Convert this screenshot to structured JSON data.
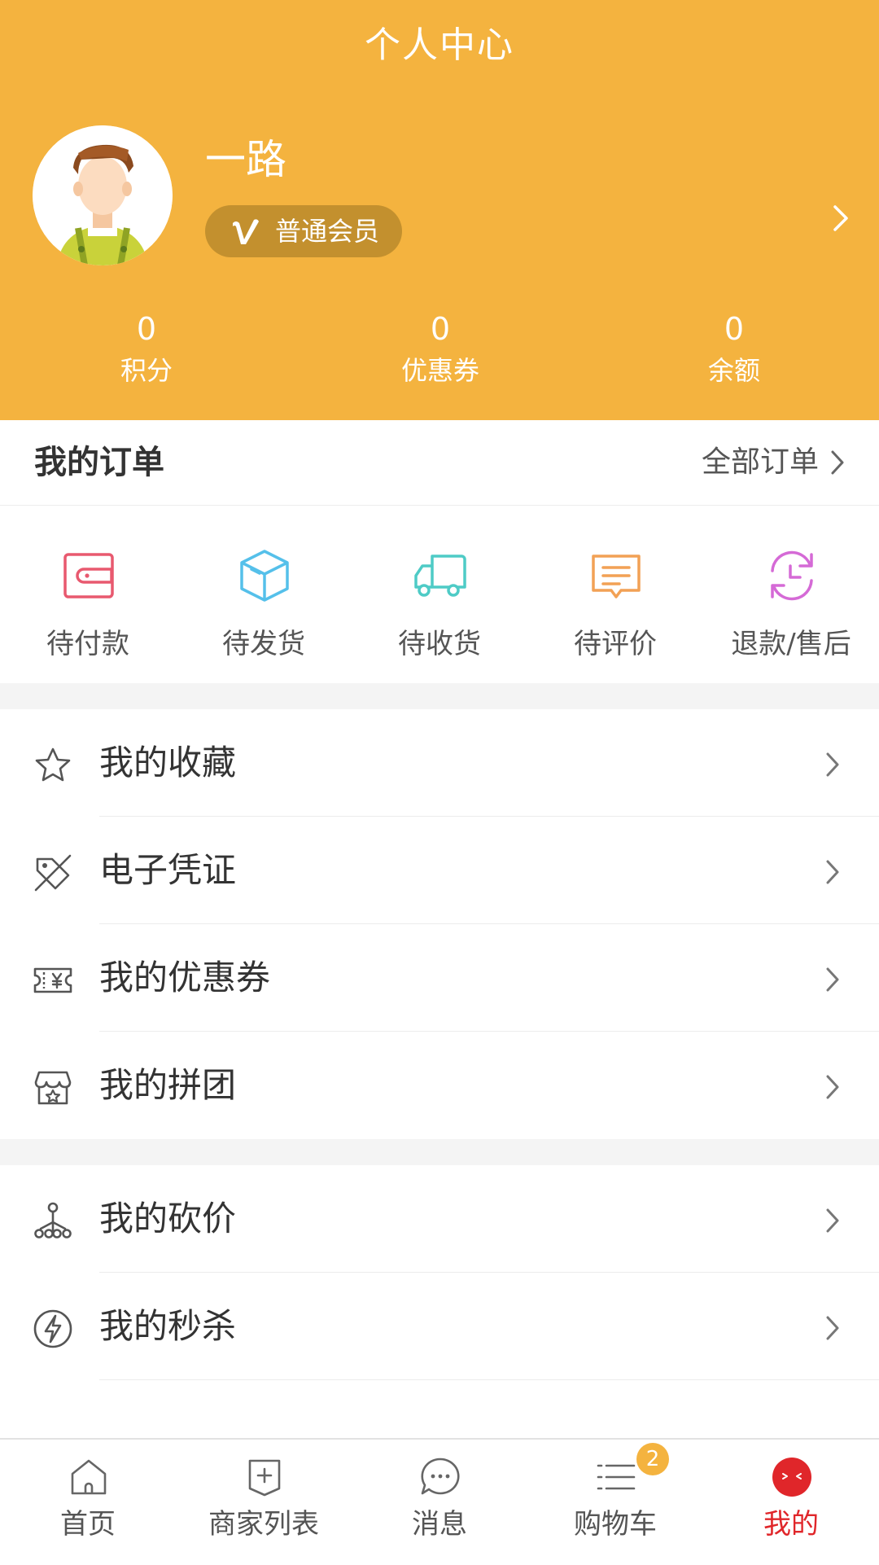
{
  "header": {
    "title": "个人中心",
    "username": "一路",
    "member_level": "普通会员",
    "stats": [
      {
        "value": "0",
        "label": "积分"
      },
      {
        "value": "0",
        "label": "优惠券"
      },
      {
        "value": "0",
        "label": "余额"
      }
    ]
  },
  "orders": {
    "title": "我的订单",
    "all_label": "全部订单",
    "statuses": [
      {
        "label": "待付款",
        "icon": "wallet-icon",
        "color": "#e8596f"
      },
      {
        "label": "待发货",
        "icon": "box-icon",
        "color": "#55c0ea"
      },
      {
        "label": "待收货",
        "icon": "truck-icon",
        "color": "#4ecbc6"
      },
      {
        "label": "待评价",
        "icon": "comment-icon",
        "color": "#f2a155"
      },
      {
        "label": "退款/售后",
        "icon": "refund-icon",
        "color": "#d56ad6"
      }
    ]
  },
  "menu": {
    "items": [
      {
        "label": "我的收藏",
        "icon": "star-icon"
      },
      {
        "label": "电子凭证",
        "icon": "voucher-tag-icon"
      },
      {
        "label": "我的优惠券",
        "icon": "coupon-icon"
      },
      {
        "label": "我的拼团",
        "icon": "store-icon"
      },
      {
        "label": "我的砍价",
        "icon": "bargain-icon"
      },
      {
        "label": "我的秒杀",
        "icon": "lightning-icon"
      }
    ]
  },
  "tabbar": {
    "tabs": [
      {
        "label": "首页",
        "icon": "home-icon"
      },
      {
        "label": "商家列表",
        "icon": "merchant-list-icon"
      },
      {
        "label": "消息",
        "icon": "message-icon"
      },
      {
        "label": "购物车",
        "icon": "cart-list-icon"
      },
      {
        "label": "我的",
        "icon": "profile-face-icon"
      }
    ],
    "cart_count": "2",
    "active_color": "#e0262a"
  },
  "colors": {
    "brand": "#f4b33f",
    "badge_bg": "#c3902e"
  }
}
